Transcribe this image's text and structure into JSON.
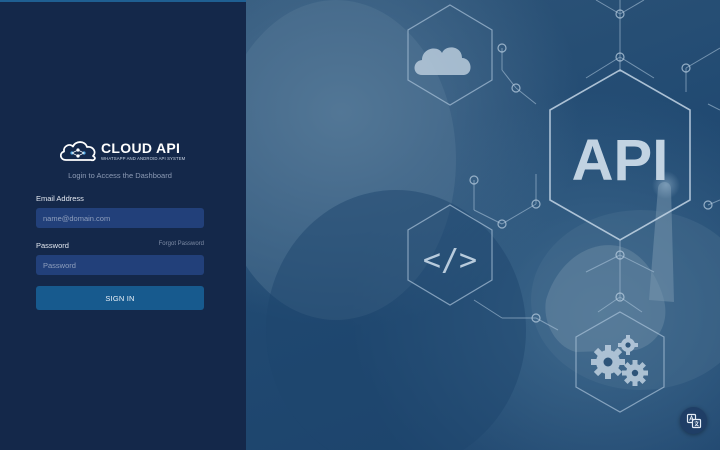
{
  "brand": {
    "title": "CLOUD API",
    "tagline": "WHATSAPP AND ANDROID API SYSTEM"
  },
  "login": {
    "subtitle": "Login to Access the Dashboard",
    "email_label": "Email Address",
    "email_placeholder": "name@domain.com",
    "password_label": "Password",
    "forgot_label": "Forgot Password",
    "password_placeholder": "Password",
    "signin_label": "SIGN IN"
  },
  "hero": {
    "api_text": "API",
    "code_text": "</>",
    "icons": [
      "cloud-icon",
      "code-icon",
      "gears-icon"
    ]
  },
  "floating": {
    "icon": "translate-icon"
  },
  "colors": {
    "panel": "#14284a",
    "input": "#22407a",
    "button": "#175a8e",
    "hero": "#2a5277"
  }
}
